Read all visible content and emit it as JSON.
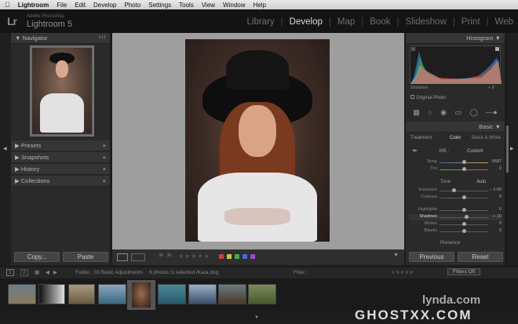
{
  "menubar": {
    "apple": "",
    "app": "Lightroom",
    "items": [
      "File",
      "Edit",
      "Develop",
      "Photo",
      "Settings",
      "Tools",
      "View",
      "Window",
      "Help"
    ]
  },
  "identity": {
    "logo": "Lr",
    "adobe": "Adobe Photoshop",
    "product": "Lightroom 5"
  },
  "modules": [
    {
      "label": "Library"
    },
    {
      "label": "Develop",
      "active": true
    },
    {
      "label": "Map"
    },
    {
      "label": "Book"
    },
    {
      "label": "Slideshow"
    },
    {
      "label": "Print"
    },
    {
      "label": "Web"
    }
  ],
  "left": {
    "navigator": "Navigator",
    "nav_fit": "FIT",
    "panels": [
      "Presets",
      "Snapshots",
      "History",
      "Collections"
    ],
    "copy": "Copy...",
    "paste": "Paste"
  },
  "right": {
    "histogram": "Histogram",
    "shadows_label": "Shadows",
    "shadows_value": "+ 8",
    "original_photo": "Original Photo",
    "basic": "Basic",
    "treatment": "Treatment :",
    "color": "Color",
    "bw": "Black & White",
    "wb": "WB :",
    "wb_value": "Custom",
    "tone": "Tone",
    "auto": "Auto",
    "presence": "Presence",
    "sliders": [
      {
        "label": "Temp",
        "value": "5687",
        "pos": 0.5
      },
      {
        "label": "Tint",
        "value": "0",
        "pos": 0.5
      },
      {
        "label": "Exposure",
        "value": "− 2.00",
        "pos": 0.3
      },
      {
        "label": "Contrast",
        "value": "0",
        "pos": 0.5
      },
      {
        "label": "Highlights",
        "value": "0",
        "pos": 0.5
      },
      {
        "label": "Shadows",
        "value": "+ 10",
        "pos": 0.55
      },
      {
        "label": "Whites",
        "value": "0",
        "pos": 0.5
      },
      {
        "label": "Blacks",
        "value": "0",
        "pos": 0.5
      }
    ],
    "previous": "Previous",
    "reset": "Reset"
  },
  "filmbar": {
    "pages": [
      "1",
      "2"
    ],
    "path": "Folder : 03 Basic Adjustments",
    "count": "6 photos /1 selected /Kara.dng",
    "filter": "Filter :",
    "filters_off": "Filters Off"
  },
  "watermarks": {
    "lynda": "lynda.com",
    "ghost": "GHOSTXX.COM"
  },
  "colors": {
    "labels": [
      "#d04040",
      "#d0c040",
      "#40b040",
      "#4070d0",
      "#9050c0"
    ]
  }
}
